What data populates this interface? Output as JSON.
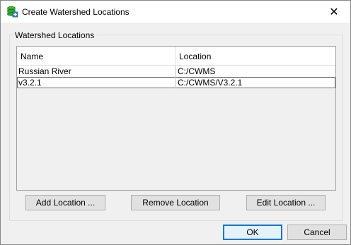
{
  "window": {
    "title": "Create Watershed Locations",
    "close_glyph": "✕"
  },
  "group": {
    "label": "Watershed Locations"
  },
  "table": {
    "columns": [
      "Name",
      "Location"
    ],
    "rows": [
      {
        "name": "Russian River",
        "location": "C:/CWMS"
      },
      {
        "name": "v3.2.1",
        "location": "C:/CWMS/V3.2.1"
      }
    ],
    "selected_row": 1
  },
  "actions": {
    "add": "Add Location ...",
    "remove": "Remove Location",
    "edit": "Edit Location ..."
  },
  "footer": {
    "ok": "OK",
    "cancel": "Cancel"
  },
  "icons": {
    "app": "green-cylinder-stack-icon",
    "close": "close-icon"
  },
  "colors": {
    "default_button_border": "#0078d7",
    "default_button_fill": "#e5f1fb",
    "dialog_background": "#f0f0f0"
  }
}
